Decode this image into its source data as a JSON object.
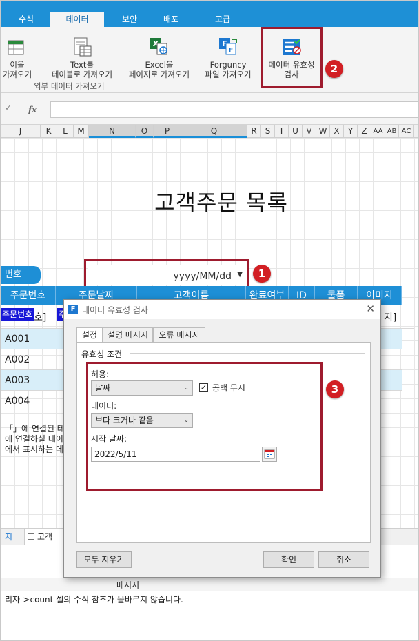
{
  "ribbon": {
    "tabs": [
      "수식",
      "데이터",
      "보안",
      "배포",
      "고급"
    ],
    "buttons": [
      {
        "line1": "이을",
        "line2": "가져오기"
      },
      {
        "line1": "Text를",
        "line2": "테이블로 가져오기"
      },
      {
        "line1": "Excel을",
        "line2": "페이지로 가져오기"
      },
      {
        "line1": "Forguncy",
        "line2": "파일 가져오기"
      },
      {
        "line1": "데이터 유효성",
        "line2": "검사"
      }
    ],
    "group_label": "외부 데이터 가져오기"
  },
  "formula_bar": {
    "fx": "fx",
    "value": ""
  },
  "columns": [
    "J",
    "K",
    "L",
    "M",
    "N",
    "O",
    "P",
    "Q",
    "R",
    "S",
    "T",
    "U",
    "V",
    "W",
    "X",
    "Y",
    "Z",
    "AA",
    "AB",
    "AC"
  ],
  "sheet": {
    "title": "고객주문 목록",
    "badge": "번호",
    "date_combo": {
      "value": "yyyy/MM/dd"
    },
    "table_headers": [
      "주문번호",
      "주문날짜",
      "고객이름",
      "완료여부",
      "ID",
      "물품",
      "이미지"
    ],
    "row_placeholder_left": "주문번호",
    "row_placeholder_suffix": "호]",
    "row_placeholder_short": "주",
    "row_placeholder_right": "지]",
    "rows": [
      "A001",
      "A002",
      "A003",
      "A004"
    ],
    "notes": [
      "「」에 연결된 테이",
      "에 연결하실 테이",
      "에서 표시하는 데"
    ]
  },
  "callouts": [
    "1",
    "2",
    "3"
  ],
  "sheet_tabs": [
    "지",
    "고객"
  ],
  "messages": {
    "header": "메시지",
    "row": "리자->count  셀의 수식 참조가 올바르지 않습니다."
  },
  "dialog": {
    "title": "데이터 유효성 검사",
    "close": "✕",
    "tabs": [
      "설정",
      "설명 메시지",
      "오류 메시지"
    ],
    "group": "유효성 조건",
    "allow_label": "허용:",
    "allow_value": "날짜",
    "ignore_blank_label": "공백 무시",
    "ignore_blank_checked": true,
    "data_label": "데이터:",
    "data_value": "보다 크거나 같음",
    "start_date_label": "시작 날짜:",
    "start_date_value": "2022/5/11",
    "clear_all": "모두 지우기",
    "ok": "확인",
    "cancel": "취소"
  },
  "colors": {
    "accent": "#1e8fd6",
    "callout": "#d21f24",
    "highlight_box": "#9e1b2e"
  }
}
